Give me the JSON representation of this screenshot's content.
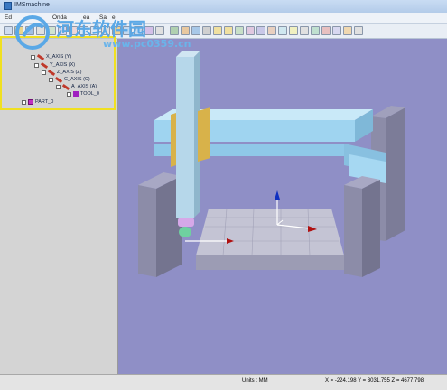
{
  "window": {
    "title": "IMSmachine"
  },
  "menu": [
    "Ed",
    "Onda",
    "ea",
    "Sa",
    "e"
  ],
  "watermark": {
    "brand": "河东软件园",
    "url": "www.pc0359.cn"
  },
  "tree": {
    "items": [
      {
        "label": "X_AXIS (Y)",
        "kind": "axis",
        "depth": 0
      },
      {
        "label": "Y_AXIS (X)",
        "kind": "axis",
        "depth": 1
      },
      {
        "label": "Z_AXIS (Z)",
        "kind": "axis",
        "depth": 2
      },
      {
        "label": "C_AXIS (C)",
        "kind": "axis",
        "depth": 3
      },
      {
        "label": "A_AXIS (A)",
        "kind": "axis",
        "depth": 4
      },
      {
        "label": "TOOL_0",
        "kind": "tool",
        "depth": 5
      },
      {
        "label": "PART_0",
        "kind": "part",
        "depth": 0
      }
    ]
  },
  "status": {
    "units": "Units : MM",
    "coords": "X = -224.198  Y = 3031.755  Z = 4677.798"
  },
  "colors": {
    "viewport_bg": "#8f8fc6",
    "highlight": "#f0e020",
    "beam": "#9fd4f0",
    "column": "#b6d7ea",
    "slide_block": "#d8b24a",
    "machine_body": "#8c8ca8",
    "table": "#b8b8c8"
  }
}
